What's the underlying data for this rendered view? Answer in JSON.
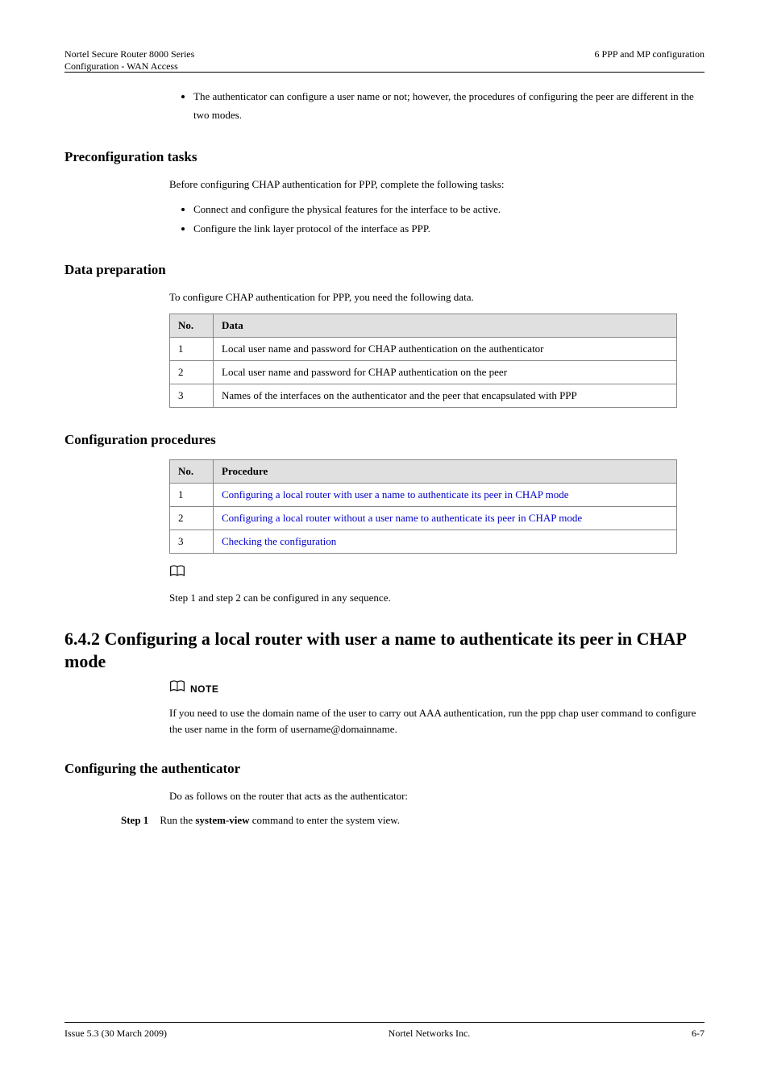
{
  "header": {
    "left_line1": "Nortel Secure Router 8000 Series",
    "left_line2": "Configuration - WAN Access",
    "right_line1": "",
    "right_line2": "6 PPP and MP configuration"
  },
  "top_bullets": [
    "The authenticator can configure a user name or not; however, the procedures of configuring the peer are different in the two modes."
  ],
  "preconfig": {
    "heading": "Preconfiguration tasks",
    "intro": "Before configuring CHAP authentication for PPP, complete the following tasks:",
    "items": [
      "Connect and configure the physical features for the interface to be active.",
      "Configure the link layer protocol of the interface as PPP."
    ]
  },
  "dataprep": {
    "heading": "Data preparation",
    "intro": "To configure CHAP authentication for PPP, you need the following data.",
    "cols": {
      "no": "No.",
      "data": "Data"
    },
    "rows": [
      {
        "no": "1",
        "data": "Local user name and password for CHAP authentication on the authenticator"
      },
      {
        "no": "2",
        "data": "Local user name and password for CHAP authentication on the peer"
      },
      {
        "no": "3",
        "data": "Names of the interfaces on the authenticator and the peer that encapsulated with PPP"
      }
    ]
  },
  "configproc": {
    "heading": "Configuration procedures",
    "cols": {
      "no": "No.",
      "proc": "Procedure"
    },
    "rows": [
      {
        "no": "1",
        "data": "Configuring a local router with user a name to authenticate its peer in CHAP mode"
      },
      {
        "no": "2",
        "data": "Configuring a local router without a user name to authenticate its peer in CHAP mode"
      },
      {
        "no": "3",
        "data": "Checking the configuration"
      }
    ]
  },
  "note_icon_only": {
    "after_text": "Step 1 and step 2 can be configured in any sequence."
  },
  "section": {
    "title": "6.4.2 Configuring a local router with user a name to authenticate its peer in CHAP mode",
    "note_label": "NOTE",
    "note_text": "If you need to use the domain name of the user to carry out AAA authentication, run the ppp chap user command to configure the user name in the form of username@domainname."
  },
  "authenticator": {
    "heading": "Configuring the authenticator",
    "intro": "Do as follows on the router that acts as the authenticator:",
    "steps": [
      {
        "label": "Step 1",
        "body_prefix": "Run the ",
        "cmd": "system-view",
        "body_suffix": " command to enter the system view."
      }
    ]
  },
  "footer": {
    "left": "Nortel Networks Inc.",
    "center": "6-7",
    "right_line1": "Issue 5.3 (30 March 2009)",
    "right_line2": ""
  }
}
